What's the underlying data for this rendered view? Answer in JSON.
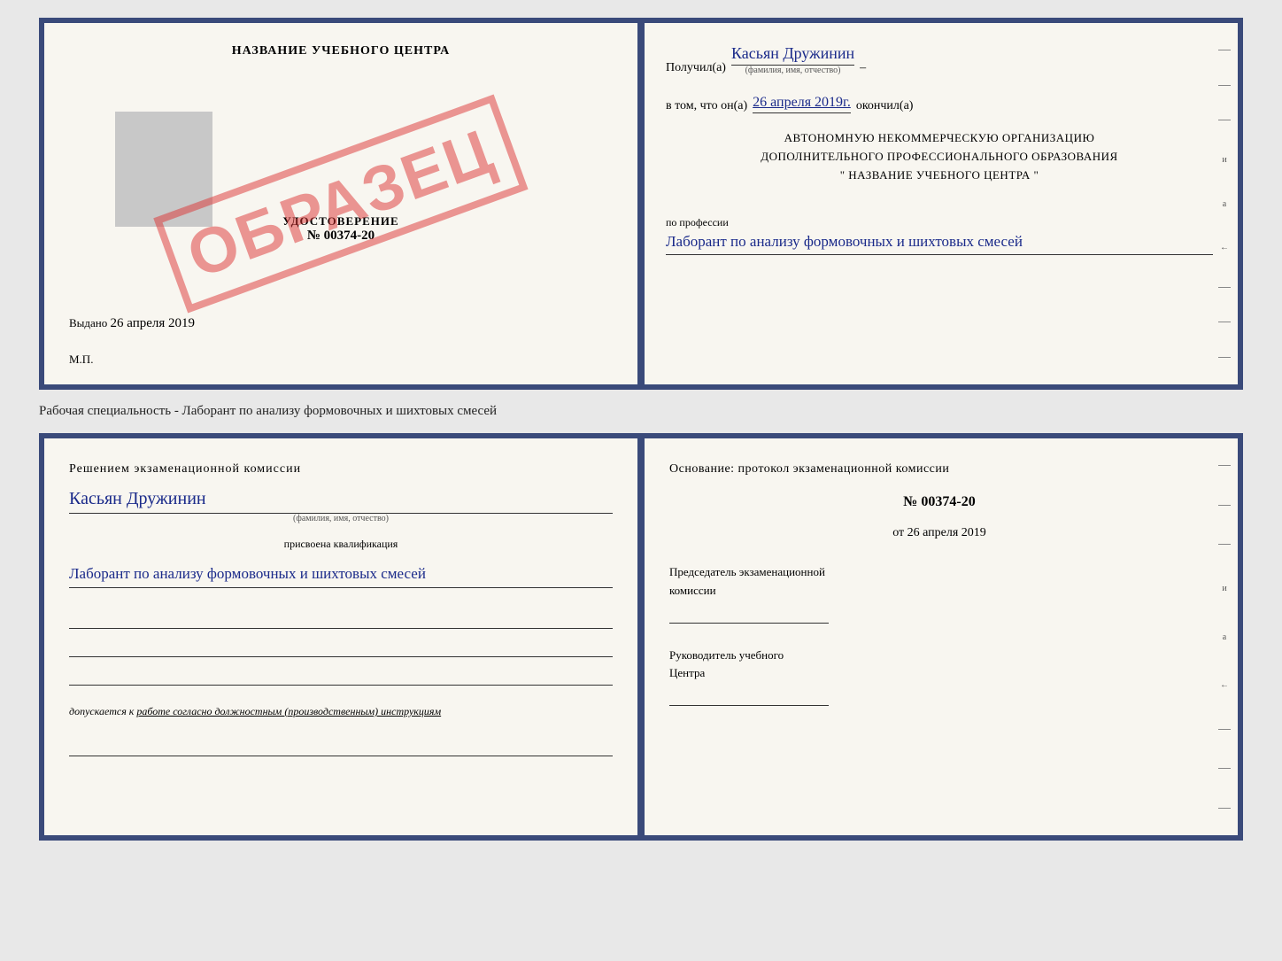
{
  "page": {
    "background_color": "#e8e8e8"
  },
  "cert_book": {
    "left": {
      "title": "НАЗВАНИЕ УЧЕБНОГО ЦЕНТРА",
      "id_label": "УДОСТОВЕРЕНИЕ",
      "id_number": "№ 00374-20",
      "issued_label": "Выдано",
      "issued_date": "26 апреля 2019",
      "mp_label": "М.П.",
      "stamp_text": "ОБРАЗЕЦ"
    },
    "right": {
      "received_prefix": "Получил(а)",
      "received_name": "Касьян Дружинин",
      "name_sublabel": "(фамилия, имя, отчество)",
      "date_prefix": "в том, что он(а)",
      "date_value": "26 апреля 2019г.",
      "date_suffix": "окончил(а)",
      "org_line1": "АВТОНОМНУЮ НЕКОММЕРЧЕСКУЮ ОРГАНИЗАЦИЮ",
      "org_line2": "ДОПОЛНИТЕЛЬНОГО ПРОФЕССИОНАЛЬНОГО ОБРАЗОВАНИЯ",
      "org_line3": "\"  НАЗВАНИЕ УЧЕБНОГО ЦЕНТРА  \"",
      "profession_prefix": "по профессии",
      "profession_handwritten": "Лаборант по анализу формовочных и шихтовых смесей",
      "side_labels": [
        "–",
        "–",
        "–",
        "и",
        "а",
        "←",
        "–",
        "–",
        "–"
      ]
    }
  },
  "specialty_line": {
    "text": "Рабочая специальность - Лаборант по анализу формовочных и шихтовых смесей"
  },
  "qual_book": {
    "left": {
      "decision_text": "Решением  экзаменационной  комиссии",
      "name_handwritten": "Касьян Дружинин",
      "name_sublabel": "(фамилия, имя, отчество)",
      "qualification_label": "присвоена квалификация",
      "qualification_handwritten": "Лаборант по анализу формовочных и шихтовых смесей",
      "допускается_prefix": "допускается к",
      "допускается_text": "работе согласно должностным (производственным) инструкциям"
    },
    "right": {
      "osnov_text": "Основание: протокол экзаменационной  комиссии",
      "proto_number": "№  00374-20",
      "date_prefix": "от",
      "date_value": "26 апреля 2019",
      "chairman_line1": "Председатель экзаменационной",
      "chairman_line2": "комиссии",
      "director_line1": "Руководитель учебного",
      "director_line2": "Центра",
      "side_labels": [
        "–",
        "–",
        "–",
        "и",
        "а",
        "←",
        "–",
        "–",
        "–"
      ]
    }
  }
}
